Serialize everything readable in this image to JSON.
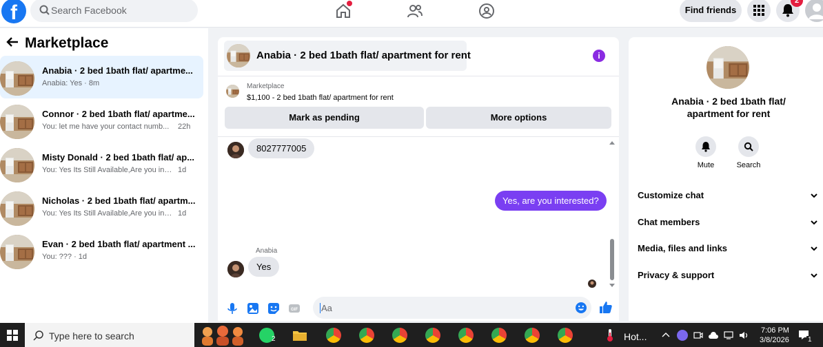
{
  "topbar": {
    "search_placeholder": "Search Facebook",
    "find_friends": "Find friends",
    "notification_count": "2"
  },
  "sidebar": {
    "title": "Marketplace",
    "conversations": [
      {
        "name": "Anabia · 2 bed 1bath flat/ apartme...",
        "snippet": "Anabia: Yes · 8m",
        "time": ""
      },
      {
        "name": "Connor · 2 bed 1bath flat/ apartme...",
        "snippet": "You: let me have your contact numb...",
        "time": "22h"
      },
      {
        "name": "Misty Donald · 2 bed 1bath flat/ ap...",
        "snippet": "You: Yes Its Still Available,Are you intre...",
        "time": "1d"
      },
      {
        "name": "Nicholas · 2 bed 1bath flat/ apartm...",
        "snippet": "You: Yes Its Still Available,Are you intre...",
        "time": "1d"
      },
      {
        "name": "Evan · 2 bed 1bath flat/ apartment ...",
        "snippet": "You: ??? · 1d",
        "time": ""
      }
    ]
  },
  "chat": {
    "title": "Anabia · 2 bed 1bath flat/ apartment for rent",
    "marketplace_label": "Marketplace",
    "listing": "$1,100 - 2 bed 1bath flat/ apartment for rent",
    "mark_pending": "Mark as pending",
    "more_options": "More options",
    "messages": [
      {
        "from": "them",
        "text": "8027777005"
      },
      {
        "from": "me",
        "text": "Yes, are you interested?"
      },
      {
        "from": "them",
        "sender": "Anabia",
        "text": "Yes"
      }
    ],
    "composer_placeholder": "Aa"
  },
  "right_panel": {
    "title": "Anabia · 2 bed 1bath flat/ apartment for rent",
    "mute": "Mute",
    "search": "Search",
    "sections": [
      "Customize chat",
      "Chat members",
      "Media, files and links",
      "Privacy & support"
    ]
  },
  "taskbar": {
    "search_placeholder": "Type here to search",
    "whatsapp_count": "2",
    "weather_text": "Hot...",
    "time": "7:06 PM",
    "date": "3/8/2026",
    "notification_count": "1"
  },
  "colors": {
    "facebook_blue": "#1877f2",
    "outgoing_bubble": "#7a3ff2",
    "badge_red": "#e41e3f"
  }
}
